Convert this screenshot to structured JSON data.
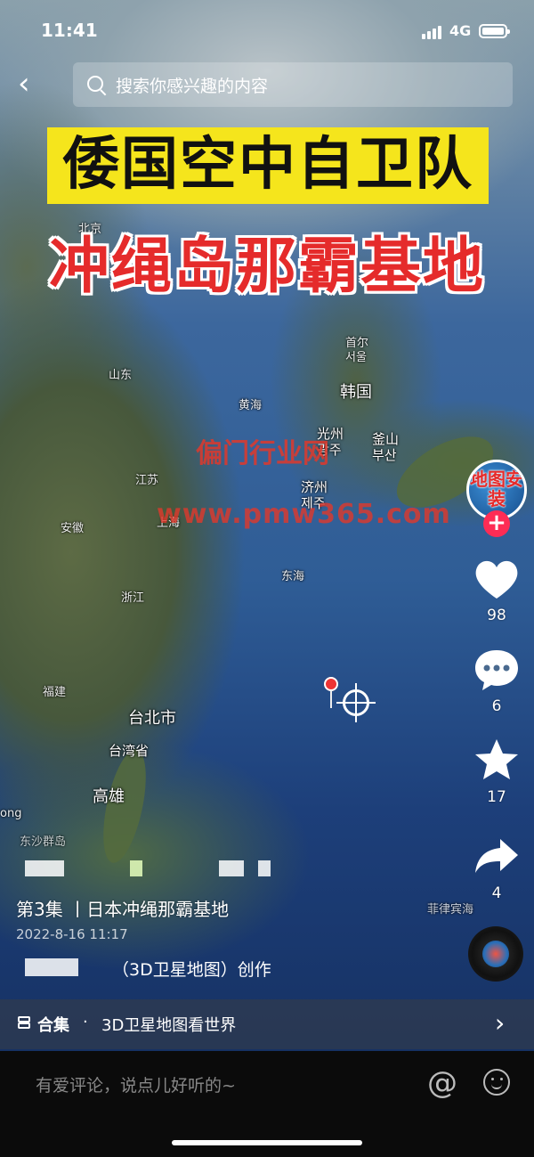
{
  "status_bar": {
    "time": "11:41",
    "network": "4G"
  },
  "search": {
    "placeholder": "搜索你感兴趣的内容"
  },
  "video": {
    "title_line1": "倭国空中自卫队",
    "title_line2": "冲绳岛那霸基地",
    "watermark_line1": "偏门行业网",
    "watermark_line2": "www.pmw365.com",
    "map_labels": {
      "beijing": "北京",
      "shandong": "山东",
      "huanghai": "黄海",
      "jiangsu": "江苏",
      "shanghai": "上海",
      "anhui": "安徽",
      "zhejiang": "浙江",
      "fujian": "福建",
      "donghai": "东海",
      "seoul_cn": "首尔",
      "seoul_kr": "서울",
      "korea": "韩国",
      "gwangju_cn": "光州",
      "gwangju_kr": "광주",
      "busan_cn": "釜山",
      "busan_kr": "부산",
      "jeju_cn": "济州",
      "jeju_kr": "제주",
      "taipei": "台北市",
      "taiwan": "台湾省",
      "kaohsiung": "高雄",
      "philippines_partial": "菲律宾海",
      "hk_partial": "ong",
      "dongsha": "东沙群岛"
    }
  },
  "rail": {
    "avatar_text": "地图安装",
    "likes": "98",
    "comments": "6",
    "favorites": "17",
    "shares": "4"
  },
  "caption": {
    "episode": "第3集 丨日本冲绳那霸基地",
    "date": "2022-8-16 11:17",
    "credit": "（3D卫星地图）创作"
  },
  "collection": {
    "label": "合集",
    "separator": "·",
    "name": "3D卫星地图看世界"
  },
  "comment_bar": {
    "placeholder": "有爱评论，说点儿好听的~"
  }
}
